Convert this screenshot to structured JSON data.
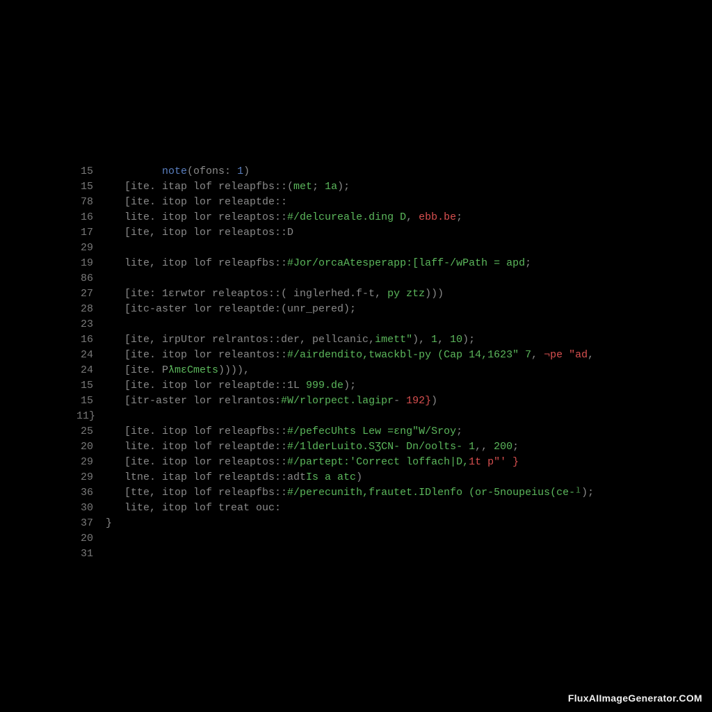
{
  "watermark": "FluxAIImageGenerator.COM",
  "lines": [
    {
      "num": "15",
      "tokens": [
        {
          "t": "         ",
          "c": "gray"
        },
        {
          "t": "note",
          "c": "blue"
        },
        {
          "t": "(ofons",
          "c": "gray"
        },
        {
          "t": ": ",
          "c": "gray"
        },
        {
          "t": "1",
          "c": "blue"
        },
        {
          "t": ")",
          "c": "gray"
        }
      ]
    },
    {
      "num": "15",
      "tokens": [
        {
          "t": "   [ite. itap lof releapfbs::(",
          "c": "gray"
        },
        {
          "t": "met",
          "c": "green"
        },
        {
          "t": "; ",
          "c": "gray"
        },
        {
          "t": "1a",
          "c": "green"
        },
        {
          "t": ");",
          "c": "gray"
        }
      ]
    },
    {
      "num": "78",
      "tokens": [
        {
          "t": "   [ite. itop lor releaptde::",
          "c": "gray"
        }
      ]
    },
    {
      "num": "16",
      "tokens": [
        {
          "t": "   lite. itop lor releaptos::",
          "c": "gray"
        },
        {
          "t": "#/delcureale.ding D",
          "c": "green"
        },
        {
          "t": ", ",
          "c": "gray"
        },
        {
          "t": "ebb.be",
          "c": "red"
        },
        {
          "t": ";",
          "c": "gray"
        }
      ]
    },
    {
      "num": "17",
      "tokens": [
        {
          "t": "   [ite, itop lor releaptos::D",
          "c": "gray"
        }
      ]
    },
    {
      "num": "29",
      "tokens": []
    },
    {
      "num": "19",
      "tokens": [
        {
          "t": "   lite, itop lof releapfbs::",
          "c": "gray"
        },
        {
          "t": "#Jor/orcaAtesperapp:[laff-/wPath = apd",
          "c": "green"
        },
        {
          "t": ";",
          "c": "gray"
        }
      ]
    },
    {
      "num": "86",
      "tokens": []
    },
    {
      "num": "27",
      "tokens": [
        {
          "t": "   [ite: 1ɛrwtor releaptos::( inglerhed.f-t, ",
          "c": "gray"
        },
        {
          "t": "py ztz",
          "c": "green"
        },
        {
          "t": ")))",
          "c": "gray"
        }
      ]
    },
    {
      "num": "28",
      "tokens": [
        {
          "t": "   [itc-aster lor releaptde:(unr_pered);",
          "c": "gray"
        }
      ]
    },
    {
      "num": "23",
      "tokens": []
    },
    {
      "num": "16",
      "tokens": [
        {
          "t": "   [ite, irpUtor relrantos::der, pellcanic,",
          "c": "gray"
        },
        {
          "t": "imett\"",
          "c": "green"
        },
        {
          "t": "), ",
          "c": "gray"
        },
        {
          "t": "1",
          "c": "green"
        },
        {
          "t": ", ",
          "c": "gray"
        },
        {
          "t": "10",
          "c": "green"
        },
        {
          "t": ");",
          "c": "gray"
        }
      ]
    },
    {
      "num": "24",
      "tokens": [
        {
          "t": "   [ite. itop lor releantos::",
          "c": "gray"
        },
        {
          "t": "#/airdendito,twackbl-py (Cap 14,1623\" 7",
          "c": "green"
        },
        {
          "t": ", ",
          "c": "gray"
        },
        {
          "t": "¬pe \"ad",
          "c": "red"
        },
        {
          "t": ",",
          "c": "gray"
        }
      ]
    },
    {
      "num": "24",
      "tokens": [
        {
          "t": "   [ite. P",
          "c": "gray"
        },
        {
          "t": "ƛmɛCmets",
          "c": "green"
        },
        {
          "t": ")))),",
          "c": "gray"
        }
      ]
    },
    {
      "num": "15",
      "tokens": [
        {
          "t": "   [ite. itop lor releaptde::1L ",
          "c": "gray"
        },
        {
          "t": "999.de",
          "c": "green"
        },
        {
          "t": ");",
          "c": "gray"
        }
      ]
    },
    {
      "num": "15",
      "tokens": [
        {
          "t": "   [itr-aster lor relrantos:",
          "c": "gray"
        },
        {
          "t": "#W/rlorpect.lagipr",
          "c": "green"
        },
        {
          "t": "- ",
          "c": "gray"
        },
        {
          "t": "192}",
          "c": "red"
        },
        {
          "t": ")",
          "c": "gray"
        }
      ]
    },
    {
      "num": "11}",
      "tokens": []
    },
    {
      "num": "25",
      "tokens": [
        {
          "t": "   [ite. itop lof releapfbs::",
          "c": "gray"
        },
        {
          "t": "#/pefecUhts Lew =ɛng\"W/Sroy",
          "c": "green"
        },
        {
          "t": ";",
          "c": "gray"
        }
      ]
    },
    {
      "num": "20",
      "tokens": [
        {
          "t": "   lite. itop lof releaptde::",
          "c": "gray"
        },
        {
          "t": "#/1lderLuito.SƷCN- Dn/oolts- 1",
          "c": "green"
        },
        {
          "t": ",, ",
          "c": "gray"
        },
        {
          "t": "200",
          "c": "green"
        },
        {
          "t": ";",
          "c": "gray"
        }
      ]
    },
    {
      "num": "29",
      "tokens": [
        {
          "t": "   [ite. itop lor releaptos::",
          "c": "gray"
        },
        {
          "t": "#/partept:'Correct loffach|D,",
          "c": "green"
        },
        {
          "t": "1t p\"' }",
          "c": "red"
        }
      ]
    },
    {
      "num": "29",
      "tokens": [
        {
          "t": "   ltne. itap lof releaptds::adt",
          "c": "gray"
        },
        {
          "t": "Is a atc",
          "c": "green"
        },
        {
          "t": ")",
          "c": "gray"
        }
      ]
    },
    {
      "num": "36",
      "tokens": [
        {
          "t": "   [tte, itop lof releapfbs::",
          "c": "gray"
        },
        {
          "t": "#/perecunith,frautet.IDlenfo (or-5noupeius(ce-ˡ",
          "c": "green"
        },
        {
          "t": ");",
          "c": "gray"
        }
      ]
    },
    {
      "num": "30",
      "tokens": [
        {
          "t": "   lite, itop lof treat ouc:",
          "c": "gray"
        }
      ]
    },
    {
      "num": "37",
      "tokens": [
        {
          "t": "}",
          "c": "gray"
        }
      ]
    },
    {
      "num": "20",
      "tokens": []
    },
    {
      "num": "31",
      "tokens": []
    }
  ]
}
